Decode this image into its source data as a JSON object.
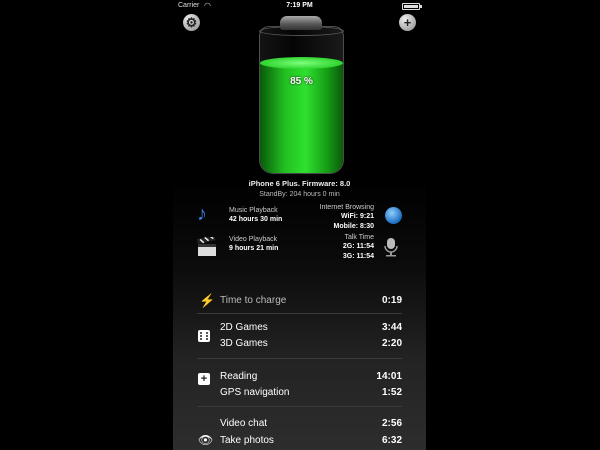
{
  "status_bar": {
    "carrier": "Carrier",
    "time": "7:19 PM"
  },
  "battery": {
    "percent_text": "85 %",
    "level": 0.85,
    "fill_color": "#22c022"
  },
  "device": {
    "title": "iPhone 6 Plus. Firmware: 8.0",
    "standby": "StandBy: 204 hours 0 min"
  },
  "stats": {
    "music": {
      "label": "Music Playback",
      "value": "42 hours 30 min"
    },
    "video": {
      "label": "Video Playback",
      "value": "9 hours 21 min"
    },
    "internet": {
      "label": "Internet Browsing",
      "wifi": "WiFi: 9:21",
      "mobile": "Mobile: 8:30"
    },
    "talk": {
      "label": "Talk Time",
      "g2": "2G: 11:54",
      "g3": "3G: 11:54"
    }
  },
  "rows": {
    "charge": {
      "label": "Time to charge",
      "value": "0:19"
    },
    "games2d": {
      "label": "2D Games",
      "value": "3:44"
    },
    "games3d": {
      "label": "3D Games",
      "value": "2:20"
    },
    "reading": {
      "label": "Reading",
      "value": "14:01"
    },
    "gps": {
      "label": "GPS navigation",
      "value": "1:52"
    },
    "videochat": {
      "label": "Video chat",
      "value": "2:56"
    },
    "photos": {
      "label": "Take photos",
      "value": "6:32"
    }
  },
  "icons": {
    "settings": "gear-icon",
    "add": "plus-icon",
    "music": "music-note-icon",
    "video": "clapperboard-icon",
    "internet": "globe-icon",
    "talk": "microphone-icon",
    "charge": "lightning-icon",
    "games": "dice-icon",
    "health": "first-aid-icon",
    "camera": "eye-icon"
  }
}
